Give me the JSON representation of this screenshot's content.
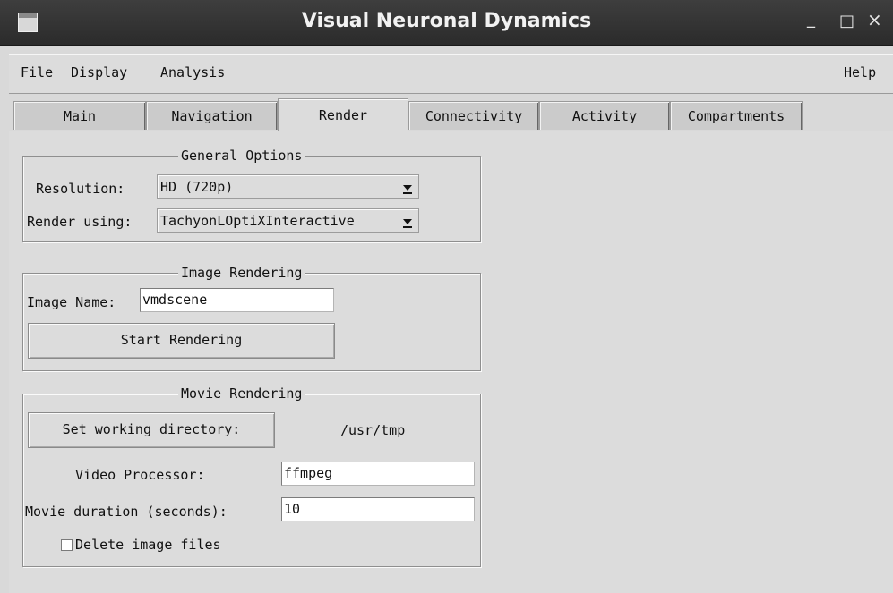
{
  "window": {
    "title": "Visual Neuronal Dynamics",
    "minimize": "_",
    "maximize": "□",
    "close": "×"
  },
  "menubar": {
    "file": "File",
    "display": "Display",
    "analysis": "Analysis",
    "help": "Help"
  },
  "tabs": [
    {
      "label": "Main"
    },
    {
      "label": "Navigation"
    },
    {
      "label": "Render",
      "active": true
    },
    {
      "label": "Connectivity"
    },
    {
      "label": "Activity"
    },
    {
      "label": "Compartments"
    }
  ],
  "general_options": {
    "title": "General Options",
    "resolution_label": "Resolution:",
    "resolution_value": "HD (720p)",
    "render_label": "Render using:",
    "render_value": "TachyonLOptiXInteractive"
  },
  "image_rendering": {
    "title": "Image Rendering",
    "name_label": "Image Name:",
    "name_value": "vmdscene",
    "start_button": "Start Rendering"
  },
  "movie_rendering": {
    "title": "Movie Rendering",
    "workdir_button": "Set working directory:",
    "workdir_value": "/usr/tmp",
    "video_label": "Video Processor:",
    "video_value": "ffmpeg",
    "duration_label": "Movie duration (seconds):",
    "duration_value": "10",
    "delete_label": "Delete image files",
    "delete_checked": false
  }
}
